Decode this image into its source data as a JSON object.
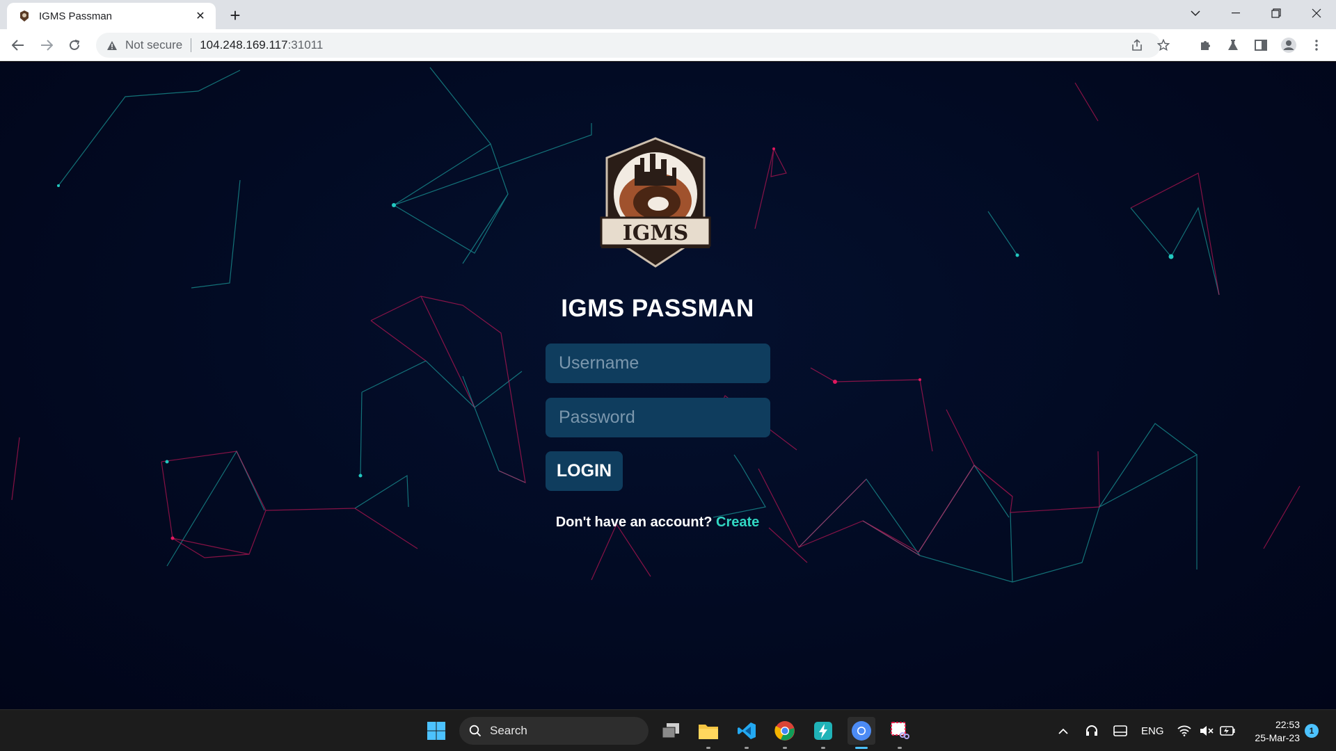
{
  "browser": {
    "tab": {
      "title": "IGMS Passman"
    },
    "address": {
      "security_label": "Not secure",
      "host": "104.248.169.117",
      "port": ":31011"
    }
  },
  "page": {
    "logo_text": "IGMS",
    "title": "IGMS PASSMAN",
    "username": {
      "value": "",
      "placeholder": "Username"
    },
    "password": {
      "value": "",
      "placeholder": "Password"
    },
    "login_label": "LOGIN",
    "signup_prompt": "Don't have an account?",
    "signup_link": "Create"
  },
  "taskbar": {
    "search_label": "Search",
    "language": "ENG",
    "time": "22:53",
    "date": "25-Mar-23",
    "notification_count": "1"
  },
  "colors": {
    "page_bg": "#020a22",
    "field_bg": "#0f3d5e",
    "link": "#31d7c3",
    "line_cyan": "#22c8c0",
    "line_pink": "#e0185e"
  }
}
